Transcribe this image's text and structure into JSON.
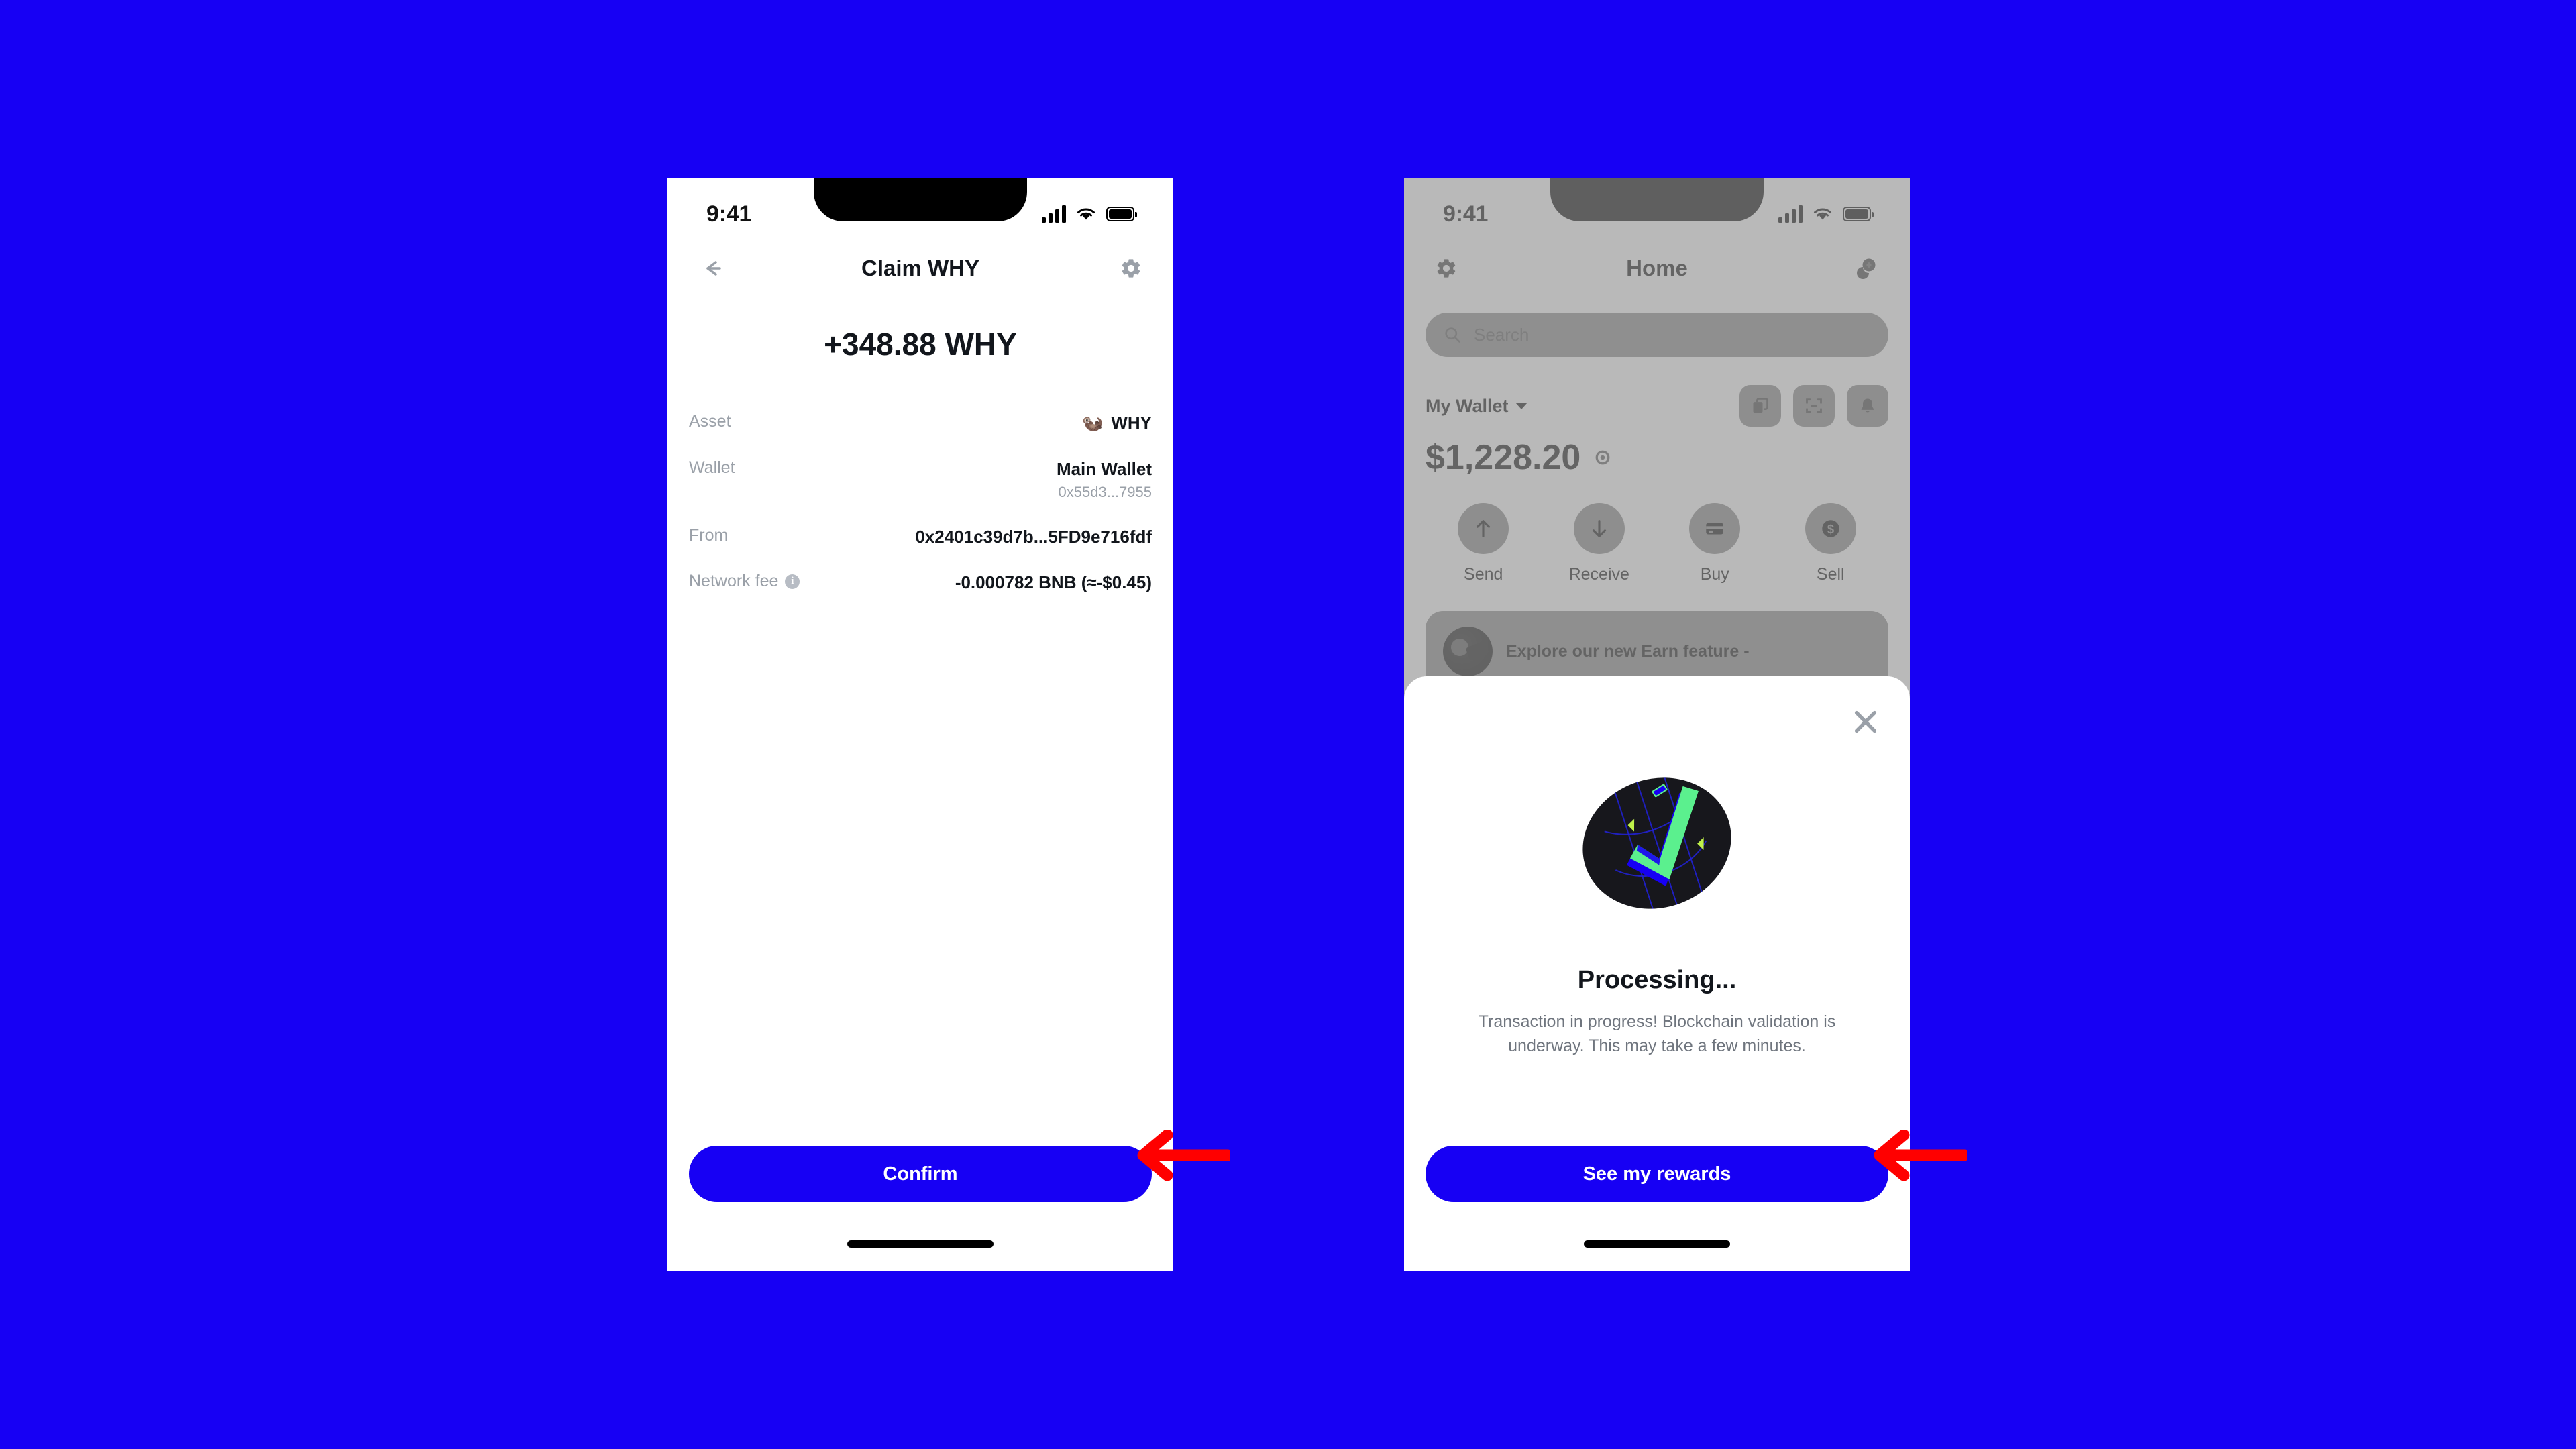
{
  "background_color": "#1700F4",
  "accent_color": "#1700F4",
  "annotations": {
    "arrow_color": "#FF0000",
    "arrow_left_target": "Confirm",
    "arrow_right_target": "See my rewards"
  },
  "left_phone": {
    "status_bar": {
      "time": "9:41",
      "cellular_icon": "signal-bars-icon",
      "wifi_icon": "wifi-icon",
      "battery_icon": "battery-icon"
    },
    "nav": {
      "back_icon": "back-arrow-icon",
      "title": "Claim WHY",
      "settings_icon": "gear-icon"
    },
    "amount": "+348.88 WHY",
    "details": [
      {
        "label": "Asset",
        "value": "WHY",
        "sub": "",
        "icon": "🦦",
        "has_info": false
      },
      {
        "label": "Wallet",
        "value": "Main Wallet",
        "sub": "0x55d3...7955",
        "icon": "",
        "has_info": false
      },
      {
        "label": "From",
        "value": "0x2401c39d7b...5FD9e716fdf",
        "sub": "",
        "icon": "",
        "has_info": false
      },
      {
        "label": "Network fee",
        "value": "-0.000782 BNB (≈-$0.45)",
        "sub": "",
        "icon": "",
        "has_info": true
      }
    ],
    "cta_label": "Confirm"
  },
  "right_phone": {
    "status_bar": {
      "time": "9:41",
      "cellular_icon": "signal-bars-icon",
      "wifi_icon": "wifi-icon",
      "battery_icon": "battery-icon"
    },
    "nav": {
      "settings_icon": "gear-icon",
      "title": "Home",
      "tokens_icon": "coins-icon"
    },
    "search": {
      "placeholder": "Search",
      "icon": "search-icon"
    },
    "wallet": {
      "name": "My Wallet",
      "dropdown_icon": "chevron-down-icon",
      "balance": "$1,228.20",
      "visibility_icon": "eye-icon",
      "quick_icons": [
        "copy-icon",
        "scan-icon",
        "bell-icon"
      ]
    },
    "actions": [
      {
        "label": "Send",
        "icon": "arrow-up-icon"
      },
      {
        "label": "Receive",
        "icon": "arrow-down-icon"
      },
      {
        "label": "Buy",
        "icon": "credit-card-icon"
      },
      {
        "label": "Sell",
        "icon": "dollar-coin-icon"
      }
    ],
    "promo": {
      "text": "Explore our new Earn feature -",
      "art": "earn-illustration"
    },
    "modal": {
      "close_icon": "close-icon",
      "illustration": "processing-checkmark-illustration",
      "title": "Processing...",
      "description": "Transaction in progress! Blockchain validation is underway. This may take a few minutes.",
      "cta_label": "See my rewards"
    }
  }
}
